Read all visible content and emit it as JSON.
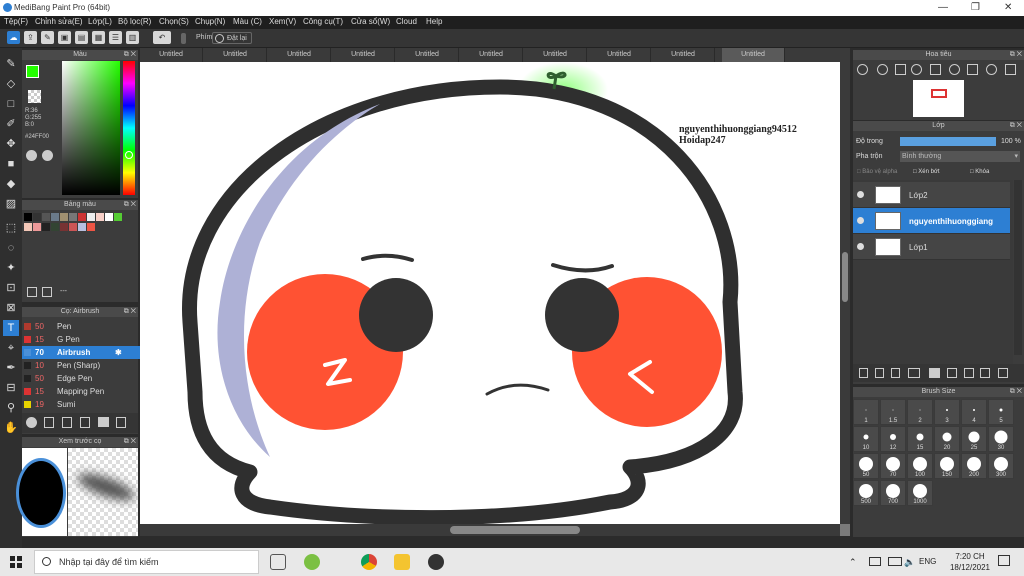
{
  "app": {
    "title": "MediBang Paint Pro (64bit)"
  },
  "menu": [
    "Tệp(F)",
    "Chỉnh sửa(E)",
    "Lớp(L)",
    "Bộ lọc(R)",
    "Chọn(S)",
    "Chụp(N)",
    "Màu (C)",
    "Xem(V)",
    "Công cụ(T)",
    "Cửa sổ(W)",
    "Cloud",
    "Help"
  ],
  "toolbar": {
    "phim_label": "Phím",
    "dat_lai_label": "Đặt lại"
  },
  "tabs": [
    "Untitled",
    "Untitled",
    "Untitled",
    "Untitled",
    "Untitled",
    "Untitled",
    "Untitled",
    "Untitled",
    "Untitled",
    "Untitled"
  ],
  "color_panel": {
    "title": "Màu",
    "rgb": "R:36\nG:255\nB:0",
    "hex": "#24FF00",
    "fg": "#24FF00"
  },
  "palette": {
    "title": "Bảng màu",
    "empty": "---"
  },
  "brush_panel": {
    "title": "Cọ: Airbrush",
    "items": [
      {
        "size": "50",
        "name": "Pen",
        "color": "#b03a2e"
      },
      {
        "size": "15",
        "name": "G Pen",
        "color": "#d33"
      },
      {
        "size": "70",
        "name": "Airbrush",
        "color": "#4a90d9"
      },
      {
        "size": "10",
        "name": "Pen (Sharp)",
        "color": "#222"
      },
      {
        "size": "50",
        "name": "Edge Pen",
        "color": "#222"
      },
      {
        "size": "15",
        "name": "Mapping Pen",
        "color": "#d33"
      },
      {
        "size": "19",
        "name": "Sumi",
        "color": "#e8d400"
      }
    ]
  },
  "preview_panel": {
    "title": "Xem trước cọ"
  },
  "navigator": {
    "title": "Hoa tiêu"
  },
  "layer_panel": {
    "title": "Lớp",
    "opacity_label": "Độ trong",
    "opacity_value": "100 %",
    "blend_label": "Pha trộn",
    "blend_value": "Bình thường",
    "protect_alpha": "Bảo vệ alpha",
    "clip": "Xén bớt",
    "lock": "Khóa",
    "layers": [
      {
        "name": "Lớp2"
      },
      {
        "name": "nguyenthihuonggiang"
      },
      {
        "name": "Lớp1"
      }
    ]
  },
  "brush_size": {
    "title": "Brush Size",
    "sizes": [
      "1",
      "1.5",
      "2",
      "3",
      "4",
      "5",
      "10",
      "12",
      "15",
      "20",
      "25",
      "30",
      "50",
      "70",
      "100",
      "150",
      "200",
      "300",
      "500",
      "700",
      "1000"
    ]
  },
  "canvas": {
    "watermark_line1": "nguyenthihuonggiang94512",
    "watermark_line2": "Hoidap247"
  },
  "taskbar": {
    "search_placeholder": "Nhập tại đây để tìm kiếm",
    "lang": "ENG",
    "time": "7:20 CH",
    "date": "18/12/2021"
  }
}
